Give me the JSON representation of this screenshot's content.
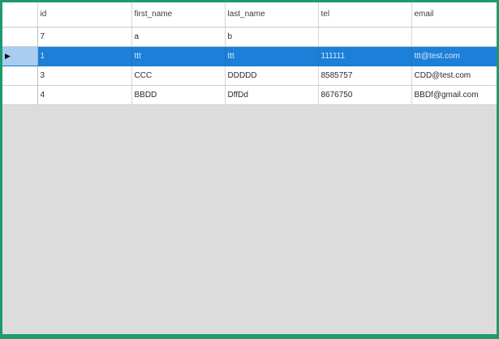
{
  "grid": {
    "columns": [
      "id",
      "first_name",
      "last_name",
      "tel",
      "email"
    ],
    "rows": [
      {
        "marker": "",
        "cells": [
          "7",
          "a",
          "b",
          "",
          ""
        ]
      },
      {
        "marker": "▶",
        "cells": [
          "1",
          "ttt",
          "ttt",
          "111111",
          "ttt@test.com"
        ]
      },
      {
        "marker": "",
        "cells": [
          "3",
          "CCC",
          "DDDDD",
          "8585757",
          "CDD@test.com"
        ]
      },
      {
        "marker": "",
        "cells": [
          "4",
          "BBDD",
          "DffDd",
          "8676750",
          "BBDf@gmail.com"
        ]
      }
    ],
    "selected_row": 1
  },
  "colors": {
    "frame": "#1f9a6b",
    "selection": "#1c7fd8",
    "selection_row_header": "#a9cdf0",
    "empty_area": "#dcdcdc"
  }
}
